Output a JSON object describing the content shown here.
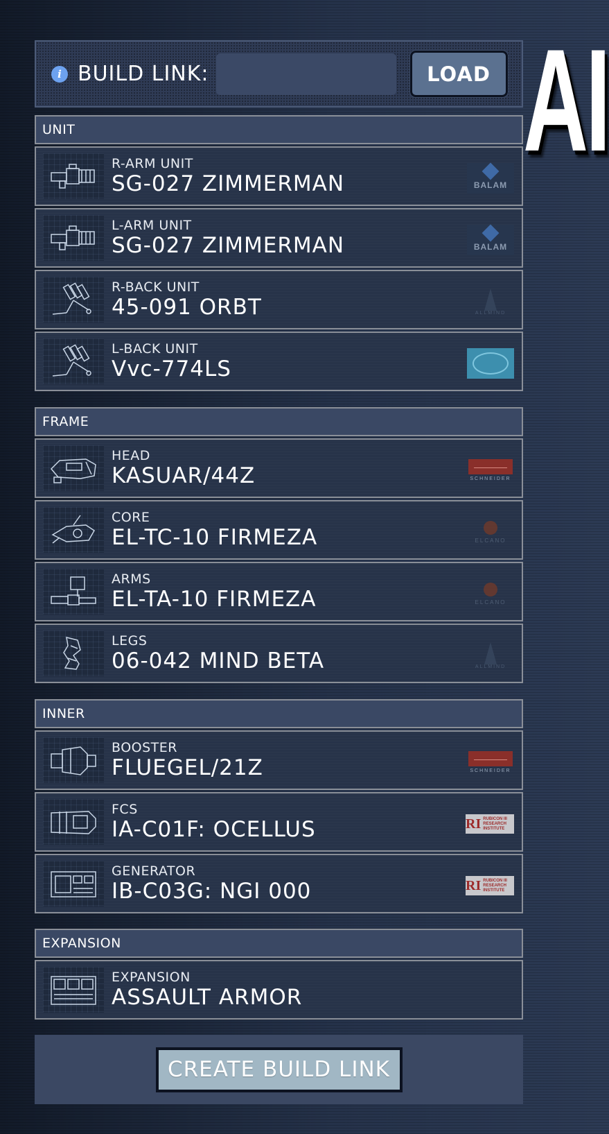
{
  "title_fragment": "AI",
  "build_link": {
    "info_icon": "info-icon",
    "label": "BUILD LINK:",
    "input_value": "",
    "input_placeholder": "",
    "load_label": "LOAD"
  },
  "sections": [
    {
      "header": "UNIT",
      "parts": [
        {
          "slot": "R-ARM UNIT",
          "name": "SG-027 ZIMMERMAN",
          "icon": "rifle-icon",
          "maker_logo": "balam-logo",
          "maker_text": "BALAM"
        },
        {
          "slot": "L-ARM UNIT",
          "name": "SG-027 ZIMMERMAN",
          "icon": "rifle-icon",
          "maker_logo": "balam-logo",
          "maker_text": "BALAM"
        },
        {
          "slot": "R-BACK UNIT",
          "name": "45-091 ORBT",
          "icon": "missile-launcher-icon",
          "maker_logo": "allmind-logo",
          "maker_text": "ALLMIND"
        },
        {
          "slot": "L-BACK UNIT",
          "name": "Vvc-774LS",
          "icon": "missile-launcher-icon",
          "maker_logo": "vvc-logo",
          "maker_text": ""
        }
      ]
    },
    {
      "header": "FRAME",
      "parts": [
        {
          "slot": "HEAD",
          "name": "KASUAR/44Z",
          "icon": "head-part-icon",
          "maker_logo": "schneider-logo",
          "maker_text": "SCHNEIDER"
        },
        {
          "slot": "CORE",
          "name": "EL-TC-10 FIRMEZA",
          "icon": "core-part-icon",
          "maker_logo": "elcano-logo",
          "maker_text": "ELCANO"
        },
        {
          "slot": "ARMS",
          "name": "EL-TA-10 FIRMEZA",
          "icon": "arms-part-icon",
          "maker_logo": "elcano-logo",
          "maker_text": "ELCANO"
        },
        {
          "slot": "LEGS",
          "name": "06-042 MIND BETA",
          "icon": "legs-part-icon",
          "maker_logo": "allmind-logo",
          "maker_text": "ALLMIND"
        }
      ]
    },
    {
      "header": "INNER",
      "parts": [
        {
          "slot": "BOOSTER",
          "name": "FLUEGEL/21Z",
          "icon": "booster-part-icon",
          "maker_logo": "schneider-logo",
          "maker_text": "SCHNEIDER"
        },
        {
          "slot": "FCS",
          "name": "IA-C01F: OCELLUS",
          "icon": "fcs-part-icon",
          "maker_logo": "rubicon-logo",
          "maker_text": "RUBICON III RESEARCH INSTITUTE",
          "maker_mark": "RI"
        },
        {
          "slot": "GENERATOR",
          "name": "IB-C03G: NGI 000",
          "icon": "generator-part-icon",
          "maker_logo": "rubicon-logo",
          "maker_text": "RUBICON III RESEARCH INSTITUTE",
          "maker_mark": "RI"
        }
      ]
    },
    {
      "header": "EXPANSION",
      "parts": [
        {
          "slot": "EXPANSION",
          "name": "ASSAULT ARMOR",
          "icon": "expansion-part-icon",
          "maker_logo": "",
          "maker_text": ""
        }
      ]
    }
  ],
  "create_button_label": "CREATE BUILD LINK",
  "colors": {
    "background": "#1b2638",
    "panel": "#273349",
    "header": "#3a4864",
    "border": "#8a8f98",
    "load_button": "#5b7190",
    "create_button": "#a1b7c4"
  }
}
